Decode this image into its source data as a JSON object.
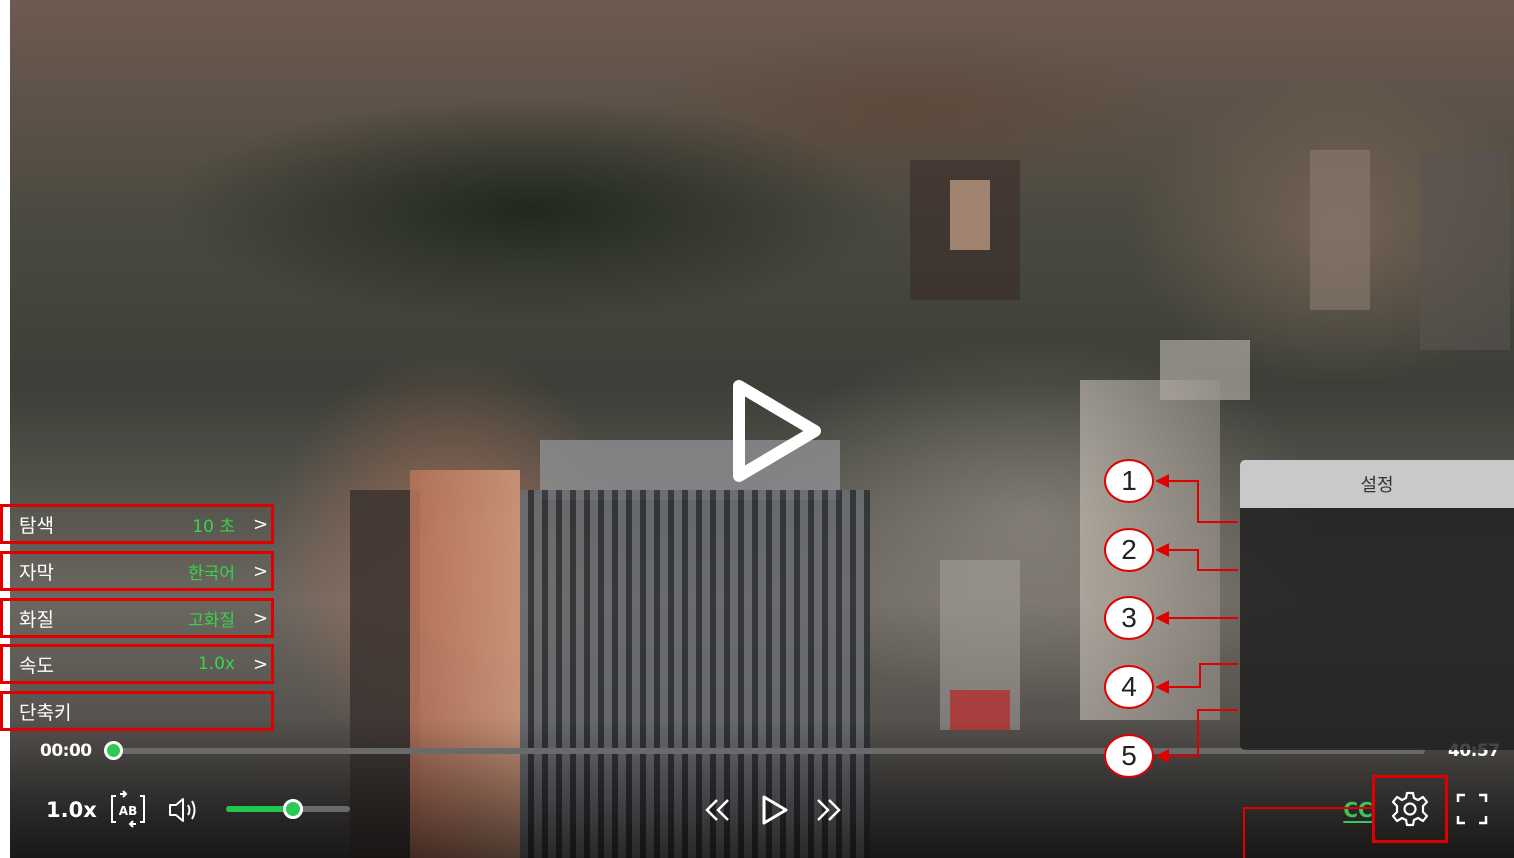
{
  "player": {
    "current_time": "00:00",
    "total_time": "40:57",
    "progress": 0.0,
    "volume": 0.55,
    "speed_label": "1.0x",
    "cc_label": "CC"
  },
  "settings": {
    "title": "설정",
    "items": [
      {
        "label": "탐색",
        "value": "10 초",
        "chevron": ">"
      },
      {
        "label": "자막",
        "value": "한국어",
        "chevron": ">"
      },
      {
        "label": "화질",
        "value": "고화질",
        "chevron": ">"
      },
      {
        "label": "속도",
        "value": "1.0x",
        "chevron": ">"
      },
      {
        "label": "단축키",
        "value": "",
        "chevron": ""
      }
    ]
  },
  "annotations": [
    "1",
    "2",
    "3",
    "4",
    "5"
  ],
  "colors": {
    "accent": "#22b24c",
    "value_text": "#37d548",
    "annotation": "#e00000"
  },
  "icons": [
    "play-icon",
    "ab-repeat-icon",
    "volume-icon",
    "rewind-icon",
    "fast-forward-icon",
    "gear-icon",
    "fullscreen-icon"
  ]
}
